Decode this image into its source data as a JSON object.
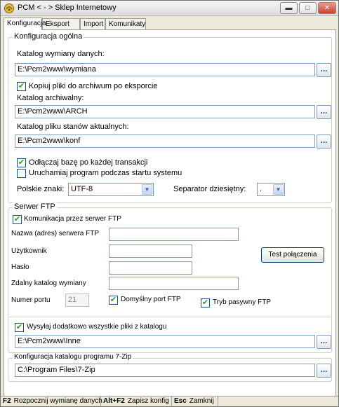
{
  "window": {
    "title": "PCM  < - >  Sklep Internetowy",
    "minimize_icon": "minimize-icon",
    "maximize_icon": "maximize-icon",
    "close_icon": "close-icon"
  },
  "tabs": [
    {
      "label": "Konfiguracja",
      "active": true
    },
    {
      "label": "Eksport",
      "active": false
    },
    {
      "label": "Import",
      "active": false
    },
    {
      "label": "Komunikaty",
      "active": false
    }
  ],
  "general": {
    "title": "Konfiguracja ogólna",
    "exchange_dir_label": "Katalog wymiany danych:",
    "exchange_dir_value": "E:\\Pcm2www\\wymiana",
    "copy_to_archive_label": "Kopiuj pliki do archiwum po eksporcie",
    "copy_to_archive_checked": true,
    "archive_dir_label": "Katalog archiwalny:",
    "archive_dir_value": "E:\\Pcm2www\\ARCH",
    "stock_dir_label": "Katalog pliku stanów aktualnych:",
    "stock_dir_value": "E:\\Pcm2www\\konf",
    "disconnect_label": "Odłączaj bazę po każdej transakcji",
    "disconnect_checked": true,
    "autostart_label": "Uruchamiaj program podczas startu systemu",
    "autostart_checked": false,
    "polish_chars_label": "Polskie znaki:",
    "polish_chars_value": "UTF-8",
    "decimal_sep_label": "Separator dziesiętny:",
    "decimal_sep_value": ".",
    "browse_label": "..."
  },
  "ftp": {
    "title": "Serwer FTP",
    "use_ftp_label": "Komunikacja przez serwer FTP",
    "use_ftp_checked": true,
    "server_label": "Nazwa (adres) serwera FTP",
    "server_value": "",
    "user_label": "Użytkownik",
    "user_value": "",
    "password_label": "Hasło",
    "password_value": "",
    "remote_dir_label": "Zdalny katalog wymiany",
    "remote_dir_value": "",
    "test_button_label": "Test połączenia",
    "port_label": "Numer portu",
    "port_value": "21",
    "default_port_label": "Domyślny port FTP",
    "default_port_checked": true,
    "passive_label": "Tryb pasywny FTP",
    "passive_checked": true,
    "send_all_label": "Wysyłaj dodatkowo wszystkie pliki z katalogu",
    "send_all_checked": true,
    "send_all_dir_value": "E:\\Pcm2www\\Inne"
  },
  "zip": {
    "title": "Konfiguracja katalogu programu 7-Zip",
    "dir_value": "C:\\Program Files\\7-Zip"
  },
  "status": [
    {
      "key": "F2",
      "text": "Rozpocznij wymianę danych"
    },
    {
      "key": "Alt+F2",
      "text": "Zapisz konfig"
    },
    {
      "key": "Esc",
      "text": "Zamknij"
    }
  ],
  "check_mark": "✔"
}
